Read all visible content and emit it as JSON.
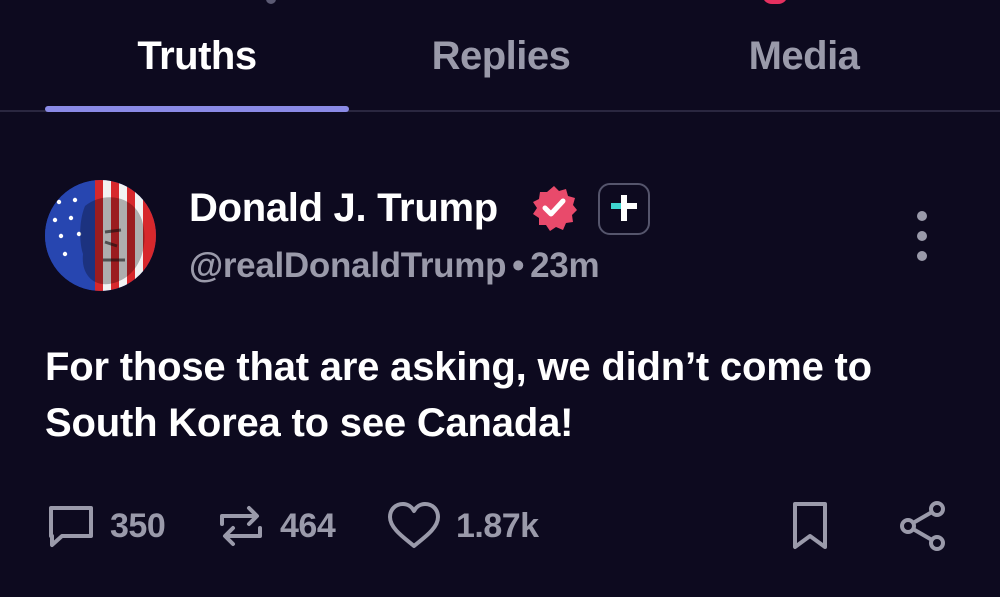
{
  "tabs": [
    {
      "label": "Truths",
      "active": true
    },
    {
      "label": "Replies",
      "active": false
    },
    {
      "label": "Media",
      "active": false
    }
  ],
  "post": {
    "author": {
      "display_name": "Donald J. Trump",
      "handle": "@realDonaldTrump",
      "separator": "•",
      "timestamp": "23m",
      "verified": true
    },
    "text": "For those that are asking, we didn’t come to South Korea to see Canada!",
    "actions": {
      "replies": "350",
      "retruths": "464",
      "likes": "1.87k"
    }
  },
  "icons": {
    "reply": "speech-bubble-icon",
    "retruth": "repost-arrows-icon",
    "like": "heart-icon",
    "bookmark": "bookmark-icon",
    "share": "share-icon",
    "more": "vertical-dots-icon",
    "verified": "verified-badge-icon",
    "plus": "truth-plus-icon"
  },
  "colors": {
    "background": "#0d0a1f",
    "tab_indicator": "#8a8ae6",
    "muted_text": "#9a9aaa",
    "verified_badge": "#e94a6b",
    "plus_accent": "#3fd6d0"
  }
}
